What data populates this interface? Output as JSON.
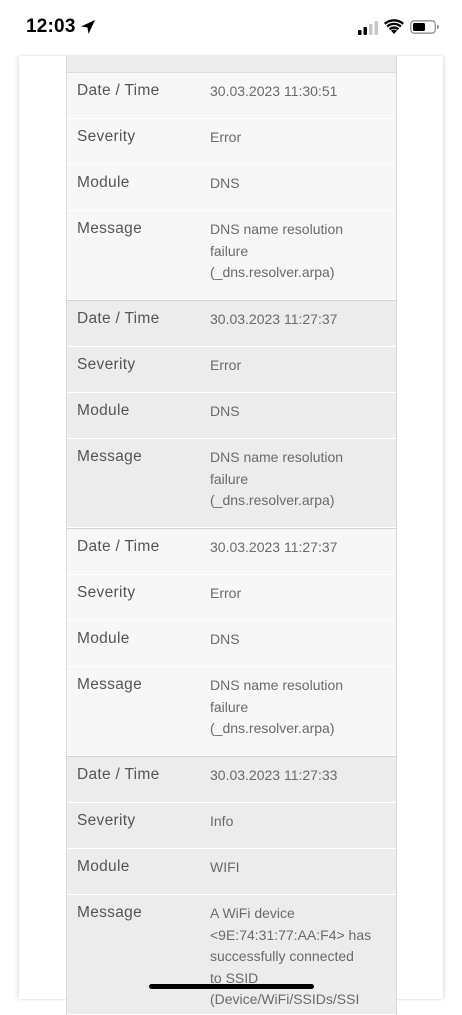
{
  "status_bar": {
    "time": "12:03",
    "icons": [
      "location-arrow-icon",
      "cellular-signal-icon",
      "wifi-icon",
      "battery-icon"
    ]
  },
  "labels": {
    "datetime": "Date / Time",
    "severity": "Severity",
    "module": "Module",
    "message": "Message"
  },
  "entries": [
    {
      "datetime": "30.03.2023 11:30:51",
      "severity": "Error",
      "module": "DNS",
      "message_lines": [
        "DNS name resolution",
        "failure",
        "(_dns.resolver.arpa)"
      ]
    },
    {
      "datetime": "30.03.2023 11:27:37",
      "severity": "Error",
      "module": "DNS",
      "message_lines": [
        "DNS name resolution",
        "failure",
        "(_dns.resolver.arpa)"
      ]
    },
    {
      "datetime": "30.03.2023 11:27:37",
      "severity": "Error",
      "module": "DNS",
      "message_lines": [
        "DNS name resolution",
        "failure",
        "(_dns.resolver.arpa)"
      ]
    },
    {
      "datetime": "30.03.2023 11:27:33",
      "severity": "Info",
      "module": "WIFI",
      "message_lines": [
        "A WiFi device",
        "<9E:74:31:77:AA:F4> has",
        "successfully connected",
        "to SSID",
        "(Device/WiFi/SSIDs/SSI"
      ]
    }
  ]
}
